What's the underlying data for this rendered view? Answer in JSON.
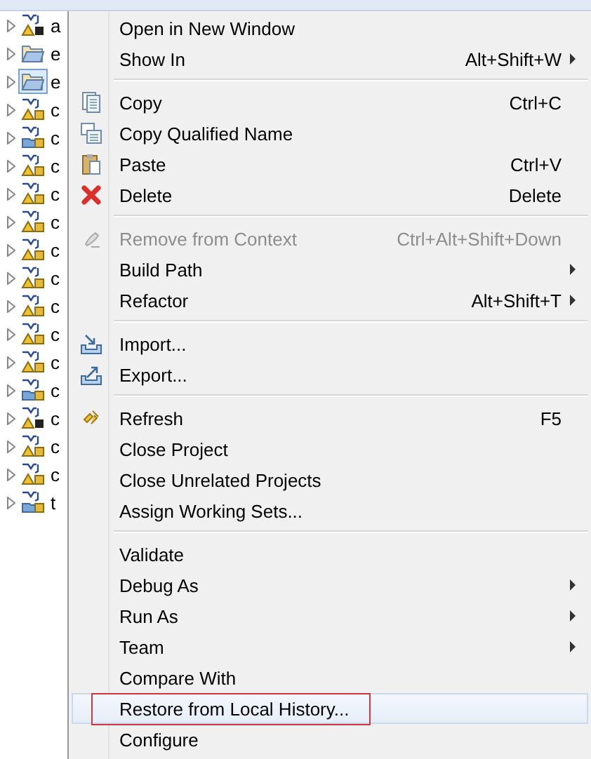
{
  "tree": {
    "items": [
      {
        "label": "a",
        "kind": "project-alt",
        "selected": false
      },
      {
        "label": "e",
        "kind": "folder",
        "selected": false
      },
      {
        "label": "e",
        "kind": "folder",
        "selected": true
      },
      {
        "label": "c",
        "kind": "project",
        "selected": false
      },
      {
        "label": "c",
        "kind": "project-folder",
        "selected": false
      },
      {
        "label": "c",
        "kind": "project",
        "selected": false
      },
      {
        "label": "c",
        "kind": "project",
        "selected": false
      },
      {
        "label": "c",
        "kind": "project",
        "selected": false
      },
      {
        "label": "c",
        "kind": "project",
        "selected": false
      },
      {
        "label": "c",
        "kind": "project",
        "selected": false
      },
      {
        "label": "c",
        "kind": "project",
        "selected": false
      },
      {
        "label": "c",
        "kind": "project",
        "selected": false
      },
      {
        "label": "c",
        "kind": "project",
        "selected": false
      },
      {
        "label": "c",
        "kind": "project-folder",
        "selected": false
      },
      {
        "label": "c",
        "kind": "project-alt",
        "selected": false
      },
      {
        "label": "c",
        "kind": "project",
        "selected": false
      },
      {
        "label": "c",
        "kind": "project",
        "selected": false
      },
      {
        "label": "t",
        "kind": "project-folder",
        "selected": false
      }
    ]
  },
  "context_menu": {
    "items": [
      {
        "kind": "item",
        "label": "Open in New Window",
        "submenu": false,
        "disabled": false,
        "selected": false
      },
      {
        "kind": "item",
        "label": "Show In",
        "shortcut": "Alt+Shift+W",
        "submenu": true,
        "disabled": false,
        "selected": false
      },
      {
        "kind": "separator"
      },
      {
        "kind": "item",
        "label": "Copy",
        "shortcut": "Ctrl+C",
        "submenu": false,
        "disabled": false,
        "selected": false
      },
      {
        "kind": "item",
        "label": "Copy Qualified Name",
        "submenu": false,
        "disabled": false,
        "selected": false
      },
      {
        "kind": "item",
        "label": "Paste",
        "shortcut": "Ctrl+V",
        "submenu": false,
        "disabled": false,
        "selected": false
      },
      {
        "kind": "item",
        "label": "Delete",
        "shortcut": "Delete",
        "submenu": false,
        "disabled": false,
        "selected": false
      },
      {
        "kind": "separator"
      },
      {
        "kind": "item",
        "label": "Remove from Context",
        "shortcut": "Ctrl+Alt+Shift+Down",
        "submenu": false,
        "disabled": true,
        "selected": false
      },
      {
        "kind": "item",
        "label": "Build Path",
        "submenu": true,
        "disabled": false,
        "selected": false
      },
      {
        "kind": "item",
        "label": "Refactor",
        "shortcut": "Alt+Shift+T",
        "submenu": true,
        "disabled": false,
        "selected": false
      },
      {
        "kind": "separator"
      },
      {
        "kind": "item",
        "label": "Import...",
        "submenu": false,
        "disabled": false,
        "selected": false
      },
      {
        "kind": "item",
        "label": "Export...",
        "submenu": false,
        "disabled": false,
        "selected": false
      },
      {
        "kind": "separator"
      },
      {
        "kind": "item",
        "label": "Refresh",
        "shortcut": "F5",
        "submenu": false,
        "disabled": false,
        "selected": false
      },
      {
        "kind": "item",
        "label": "Close Project",
        "submenu": false,
        "disabled": false,
        "selected": false
      },
      {
        "kind": "item",
        "label": "Close Unrelated Projects",
        "submenu": false,
        "disabled": false,
        "selected": false
      },
      {
        "kind": "item",
        "label": "Assign Working Sets...",
        "submenu": false,
        "disabled": false,
        "selected": false
      },
      {
        "kind": "separator"
      },
      {
        "kind": "item",
        "label": "Validate",
        "submenu": false,
        "disabled": false,
        "selected": false
      },
      {
        "kind": "item",
        "label": "Debug As",
        "submenu": true,
        "disabled": false,
        "selected": false
      },
      {
        "kind": "item",
        "label": "Run As",
        "submenu": true,
        "disabled": false,
        "selected": false
      },
      {
        "kind": "item",
        "label": "Team",
        "submenu": true,
        "disabled": false,
        "selected": false
      },
      {
        "kind": "item",
        "label": "Compare With",
        "submenu": false,
        "disabled": false,
        "selected": false
      },
      {
        "kind": "item",
        "label": "Restore from Local History...",
        "submenu": false,
        "disabled": false,
        "selected": true,
        "boxed": true
      },
      {
        "kind": "item",
        "label": "Configure",
        "submenu": false,
        "disabled": false,
        "selected": false
      }
    ]
  }
}
